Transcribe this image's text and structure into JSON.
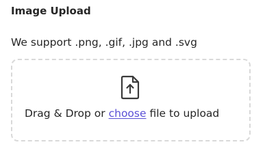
{
  "upload": {
    "title": "Image Upload",
    "supported_formats_text": "We support .png, .gif, .jpg and .svg",
    "dropzone": {
      "icon": "file-upload-icon",
      "prefix_text": "Drag & Drop or ",
      "link_text": "choose",
      "suffix_text": " file to upload"
    }
  },
  "colors": {
    "link": "#5a4fd6",
    "border": "#d9d9d9",
    "text": "#262626"
  }
}
